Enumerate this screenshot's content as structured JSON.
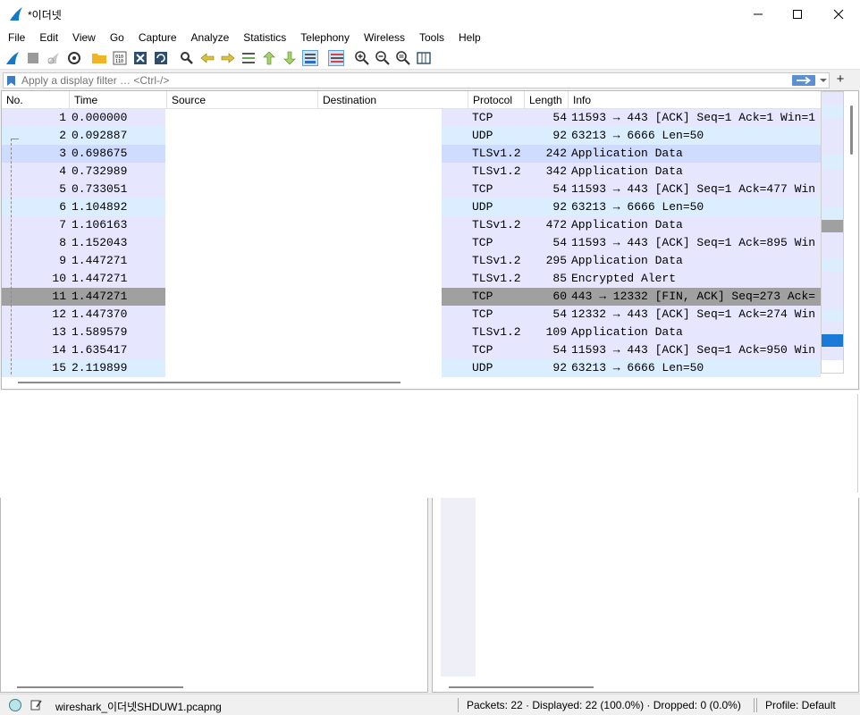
{
  "window": {
    "title": "*이더넷"
  },
  "menu": [
    "File",
    "Edit",
    "View",
    "Go",
    "Capture",
    "Analyze",
    "Statistics",
    "Telephony",
    "Wireless",
    "Tools",
    "Help"
  ],
  "filter": {
    "placeholder": "Apply a display filter … <Ctrl-/>",
    "plus": "+"
  },
  "columns": [
    "No.",
    "Time",
    "Source",
    "Destination",
    "Protocol",
    "Length",
    "Info"
  ],
  "colors": {
    "tcp_row": "#e7e6ff",
    "udp_row": "#daeeff",
    "selected_row": "#a0a0a0",
    "highlight_row": "#cfdcff",
    "minimap_marker": "#1a7ad9"
  },
  "packets": [
    {
      "no": "1",
      "time": "0.000000",
      "protocol": "TCP",
      "length": "54",
      "info": "11593 → 443 [ACK] Seq=1 Ack=1 Win=1"
    },
    {
      "no": "2",
      "time": "0.092887",
      "protocol": "UDP",
      "length": "92",
      "info": "63213 → 6666 Len=50"
    },
    {
      "no": "3",
      "time": "0.698675",
      "protocol": "TLSv1.2",
      "length": "242",
      "info": "Application Data"
    },
    {
      "no": "4",
      "time": "0.732989",
      "protocol": "TLSv1.2",
      "length": "342",
      "info": "Application Data"
    },
    {
      "no": "5",
      "time": "0.733051",
      "protocol": "TCP",
      "length": "54",
      "info": "11593 → 443 [ACK] Seq=1 Ack=477 Win"
    },
    {
      "no": "6",
      "time": "1.104892",
      "protocol": "UDP",
      "length": "92",
      "info": "63213 → 6666 Len=50"
    },
    {
      "no": "7",
      "time": "1.106163",
      "protocol": "TLSv1.2",
      "length": "472",
      "info": "Application Data"
    },
    {
      "no": "8",
      "time": "1.152043",
      "protocol": "TCP",
      "length": "54",
      "info": "11593 → 443 [ACK] Seq=1 Ack=895 Win"
    },
    {
      "no": "9",
      "time": "1.447271",
      "protocol": "TLSv1.2",
      "length": "295",
      "info": "Application Data"
    },
    {
      "no": "10",
      "time": "1.447271",
      "protocol": "TLSv1.2",
      "length": "85",
      "info": "Encrypted Alert"
    },
    {
      "no": "11",
      "time": "1.447271",
      "protocol": "TCP",
      "length": "60",
      "info": "443 → 12332 [FIN, ACK] Seq=273 Ack="
    },
    {
      "no": "12",
      "time": "1.447370",
      "protocol": "TCP",
      "length": "54",
      "info": "12332 → 443 [ACK] Seq=1 Ack=274 Win"
    },
    {
      "no": "13",
      "time": "1.589579",
      "protocol": "TLSv1.2",
      "length": "109",
      "info": "Application Data"
    },
    {
      "no": "14",
      "time": "1.635417",
      "protocol": "TCP",
      "length": "54",
      "info": "11593 → 443 [ACK] Seq=1 Ack=950 Win"
    },
    {
      "no": "15",
      "time": "2.119899",
      "protocol": "UDP",
      "length": "92",
      "info": "63213 → 6666 Len=50"
    }
  ],
  "selected_packet": "11",
  "status": {
    "file": "wireshark_이더넷SHDUW1.pcapng",
    "packets": "Packets: 22 · Displayed: 22 (100.0%) · Dropped: 0 (0.0%)",
    "profile": "Profile: Default"
  }
}
